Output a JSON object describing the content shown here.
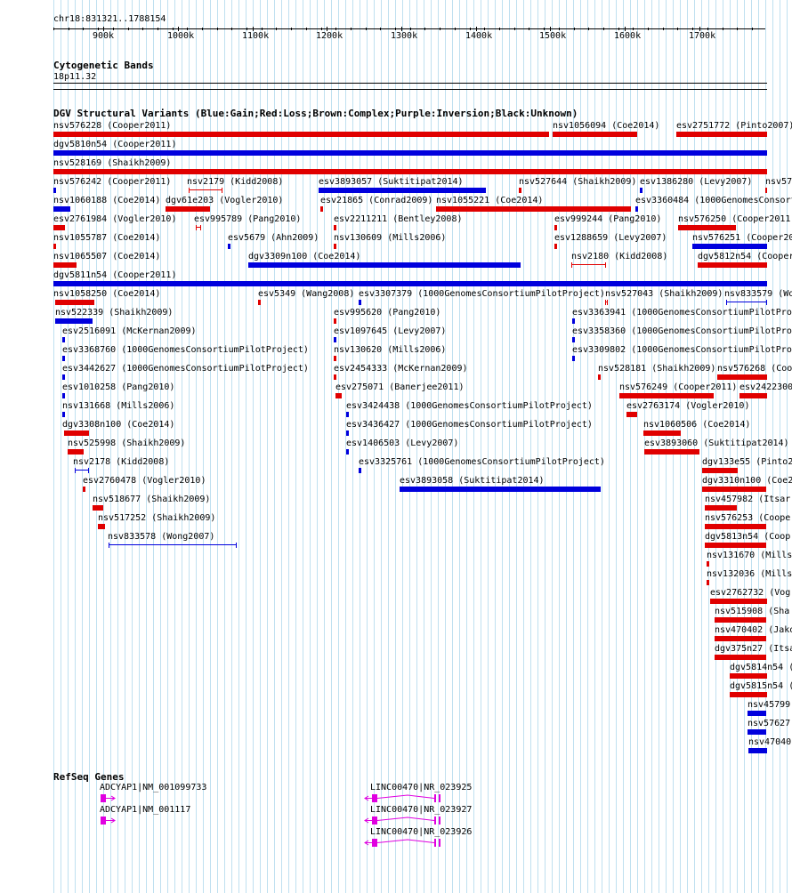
{
  "ruler": {
    "position": "chr18:831321..1788154",
    "ticks": [
      "900k",
      "1000k",
      "1100k",
      "1200k",
      "1300k",
      "1400k",
      "1500k",
      "1600k",
      "1700k"
    ]
  },
  "cytoband": {
    "title": "Cytogenetic Bands",
    "band": "18p11.32"
  },
  "dgv": {
    "title": "DGV Structural Variants (Blue:Gain;Red:Loss;Brown:Complex;Purple:Inversion;Black:Unknown)",
    "colors": {
      "gain": "#0000dd",
      "loss": "#e00000"
    },
    "variants": [
      {
        "label": "nsv576228 (Cooper2011)",
        "type": "loss"
      },
      {
        "label": "nsv1056094 (Coe2014)",
        "type": "loss"
      },
      {
        "label": "esv2751772 (Pinto2007)",
        "type": "loss"
      },
      {
        "label": "dgv5810n54 (Cooper2011)",
        "type": "gain"
      },
      {
        "label": "nsv528169 (Shaikh2009)",
        "type": "loss"
      },
      {
        "label": "nsv576242 (Cooper2011)",
        "type": "gain"
      },
      {
        "label": "nsv2179 (Kidd2008)",
        "type": "loss"
      },
      {
        "label": "esv3893057 (Suktitipat2014)",
        "type": "gain"
      },
      {
        "label": "nsv527644 (Shaikh2009)",
        "type": "loss"
      },
      {
        "label": "esv1386280 (Levy2007)",
        "type": "gain"
      },
      {
        "label": "nsv57",
        "type": "loss"
      },
      {
        "label": "nsv1060188 (Coe2014)",
        "type": "gain"
      },
      {
        "label": "dgv61e203 (Vogler2010)",
        "type": "loss"
      },
      {
        "label": "esv21865 (Conrad2009)",
        "type": "loss"
      },
      {
        "label": "nsv1055221 (Coe2014)",
        "type": "loss"
      },
      {
        "label": "esv3360484 (1000GenomesConsort",
        "type": "gain"
      },
      {
        "label": "esv2761984 (Vogler2010)",
        "type": "loss"
      },
      {
        "label": "esv995789 (Pang2010)",
        "type": "loss"
      },
      {
        "label": "esv2211211 (Bentley2008)",
        "type": "loss"
      },
      {
        "label": "esv999244 (Pang2010)",
        "type": "loss"
      },
      {
        "label": "nsv576250 (Cooper2011",
        "type": "loss"
      },
      {
        "label": "nsv1055787 (Coe2014)",
        "type": "loss"
      },
      {
        "label": "esv5679 (Ahn2009)",
        "type": "gain"
      },
      {
        "label": "nsv130609 (Mills2006)",
        "type": "loss"
      },
      {
        "label": "esv1288659 (Levy2007)",
        "type": "loss"
      },
      {
        "label": "nsv576251 (Cooper20",
        "type": "gain"
      },
      {
        "label": "nsv1065507 (Coe2014)",
        "type": "loss"
      },
      {
        "label": "dgv3309n100 (Coe2014)",
        "type": "gain"
      },
      {
        "label": "nsv2180 (Kidd2008)",
        "type": "loss"
      },
      {
        "label": "dgv5812n54 (Cooper",
        "type": "loss"
      },
      {
        "label": "dgv5811n54 (Cooper2011)",
        "type": "gain"
      },
      {
        "label": "nsv1058250 (Coe2014)",
        "type": "loss"
      },
      {
        "label": "esv5349 (Wang2008)",
        "type": "loss"
      },
      {
        "label": "esv3307379 (1000GenomesConsortiumPilotProject)",
        "type": "gain"
      },
      {
        "label": "nsv527043 (Shaikh2009)",
        "type": "loss"
      },
      {
        "label": "nsv833579 (Wo",
        "type": "gain"
      },
      {
        "label": "nsv522339 (Shaikh2009)",
        "type": "gain"
      },
      {
        "label": "esv995620 (Pang2010)",
        "type": "loss"
      },
      {
        "label": "esv3363941 (1000GenomesConsortiumPilotPro",
        "type": "gain"
      },
      {
        "label": "esv2516091 (McKernan2009)",
        "type": "gain"
      },
      {
        "label": "esv1097645 (Levy2007)",
        "type": "gain"
      },
      {
        "label": "esv3358360 (1000GenomesConsortiumPilotPro",
        "type": "gain"
      },
      {
        "label": "esv3368760 (1000GenomesConsortiumPilotProject)",
        "type": "gain"
      },
      {
        "label": "nsv130620 (Mills2006)",
        "type": "loss"
      },
      {
        "label": "esv3309802 (1000GenomesConsortiumPilotPro",
        "type": "gain"
      },
      {
        "label": "esv3442627 (1000GenomesConsortiumPilotProject)",
        "type": "gain"
      },
      {
        "label": "esv2454333 (McKernan2009)",
        "type": "loss"
      },
      {
        "label": "nsv528181 (Shaikh2009)",
        "type": "loss"
      },
      {
        "label": "nsv576268 (Coo",
        "type": "loss"
      },
      {
        "label": "esv1010258 (Pang2010)",
        "type": "gain"
      },
      {
        "label": "esv275071 (Banerjee2011)",
        "type": "loss"
      },
      {
        "label": "nsv576249 (Cooper2011)",
        "type": "loss"
      },
      {
        "label": "esv2422300",
        "type": "loss"
      },
      {
        "label": "nsv131668 (Mills2006)",
        "type": "gain"
      },
      {
        "label": "esv3424438 (1000GenomesConsortiumPilotProject)",
        "type": "gain"
      },
      {
        "label": "esv2763174 (Vogler2010)",
        "type": "loss"
      },
      {
        "label": "dgv3308n100 (Coe2014)",
        "type": "loss"
      },
      {
        "label": "esv3436427 (1000GenomesConsortiumPilotProject)",
        "type": "gain"
      },
      {
        "label": "nsv1060506 (Coe2014)",
        "type": "loss"
      },
      {
        "label": "nsv525998 (Shaikh2009)",
        "type": "loss"
      },
      {
        "label": "esv1406503 (Levy2007)",
        "type": "gain"
      },
      {
        "label": "esv3893060 (Suktitipat2014)",
        "type": "loss"
      },
      {
        "label": "nsv2178 (Kidd2008)",
        "type": "gain"
      },
      {
        "label": "esv3325761 (1000GenomesConsortiumPilotProject)",
        "type": "gain"
      },
      {
        "label": "dgv133e55 (Pinto2",
        "type": "loss"
      },
      {
        "label": "esv2760478 (Vogler2010)",
        "type": "loss"
      },
      {
        "label": "esv3893058 (Suktitipat2014)",
        "type": "gain"
      },
      {
        "label": "dgv3310n100 (Coe2",
        "type": "loss"
      },
      {
        "label": "nsv518677 (Shaikh2009)",
        "type": "loss"
      },
      {
        "label": "nsv457982 (Itsar",
        "type": "loss"
      },
      {
        "label": "nsv517252 (Shaikh2009)",
        "type": "loss"
      },
      {
        "label": "nsv576253 (Cooper",
        "type": "loss"
      },
      {
        "label": "nsv833578 (Wong2007)",
        "type": "gain"
      },
      {
        "label": "dgv5813n54 (Coop",
        "type": "loss"
      },
      {
        "label": "nsv131670 (Mills",
        "type": "loss"
      },
      {
        "label": "nsv132036 (Mills",
        "type": "loss"
      },
      {
        "label": "esv2762732 (Vog",
        "type": "loss"
      },
      {
        "label": "nsv515908 (Sha",
        "type": "loss"
      },
      {
        "label": "nsv470402 (Jako",
        "type": "loss"
      },
      {
        "label": "dgv375n27 (Itsa",
        "type": "loss"
      },
      {
        "label": "dgv5814n54 (",
        "type": "loss"
      },
      {
        "label": "dgv5815n54 (",
        "type": "loss"
      },
      {
        "label": "nsv45799",
        "type": "gain"
      },
      {
        "label": "nsv57627",
        "type": "gain"
      },
      {
        "label": "nsv47040",
        "type": "gain"
      }
    ]
  },
  "refseq": {
    "title": "RefSeq Genes",
    "color": "#e000e0",
    "genes": [
      {
        "label": "ADCYAP1|NM_001099733"
      },
      {
        "label": "ADCYAP1|NM_001117"
      },
      {
        "label": "LINC00470|NR_023925"
      },
      {
        "label": "LINC00470|NR_023927"
      },
      {
        "label": "LINC00470|NR_023926"
      }
    ]
  }
}
